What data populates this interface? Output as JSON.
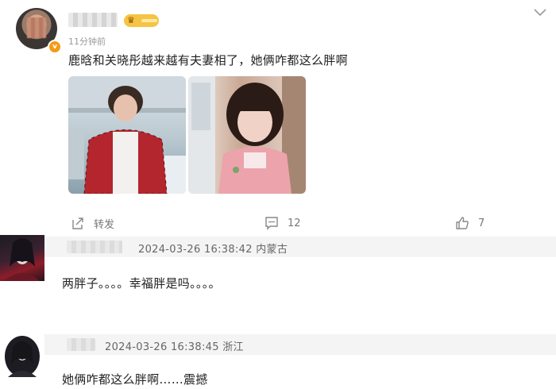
{
  "post": {
    "time": "11分钟前",
    "text": "鹿晗和关晓彤越来越有夫妻相了，她俩咋都这么胖啊",
    "vip_badge": "v",
    "crown_icon": "crown-icon"
  },
  "actions": {
    "share_label": "转发",
    "comment_count": "12",
    "like_count": "7"
  },
  "comments": [
    {
      "timestamp": "2024-03-26 16:38:42",
      "location": "内蒙古",
      "text": "两胖子。。。。幸福胖是吗。。。。"
    },
    {
      "timestamp": "2024-03-26 16:38:45",
      "location": "浙江",
      "text": "她俩咋都这么胖啊……震撼"
    }
  ],
  "colors": {
    "crown_badge": "#f6c343",
    "vip_badge": "#f49b17",
    "comment_header_bg": "#f4f4f4"
  }
}
